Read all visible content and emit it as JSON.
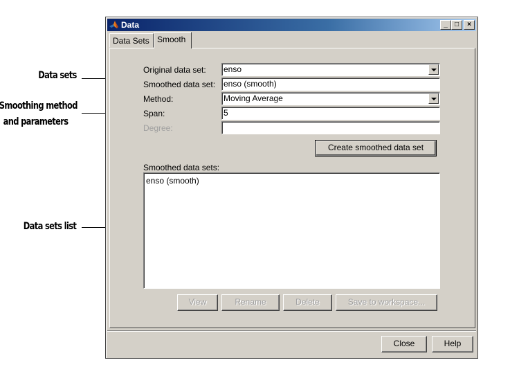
{
  "annotations": {
    "data_sets": "Data sets",
    "smoothing_line1": "Smoothing method",
    "smoothing_line2": "and parameters",
    "data_sets_list": "Data sets list"
  },
  "window": {
    "title": "Data",
    "minimize": "_",
    "maximize": "□",
    "close": "×"
  },
  "tabs": [
    {
      "label": "Data Sets",
      "active": false
    },
    {
      "label": "Smooth",
      "active": true
    }
  ],
  "form": {
    "original_label": "Original data set:",
    "original_value": "enso",
    "smoothed_label": "Smoothed data set:",
    "smoothed_value": "enso (smooth)",
    "method_label": "Method:",
    "method_value": "Moving Average",
    "span_label": "Span:",
    "span_value": "5",
    "degree_label": "Degree:",
    "degree_value": ""
  },
  "create_button": "Create smoothed data set",
  "list": {
    "label": "Smoothed data sets:",
    "items": [
      "enso (smooth)"
    ]
  },
  "list_buttons": {
    "view": "View",
    "rename": "Rename",
    "delete": "Delete",
    "save": "Save to workspace..."
  },
  "footer": {
    "close": "Close",
    "help": "Help"
  }
}
